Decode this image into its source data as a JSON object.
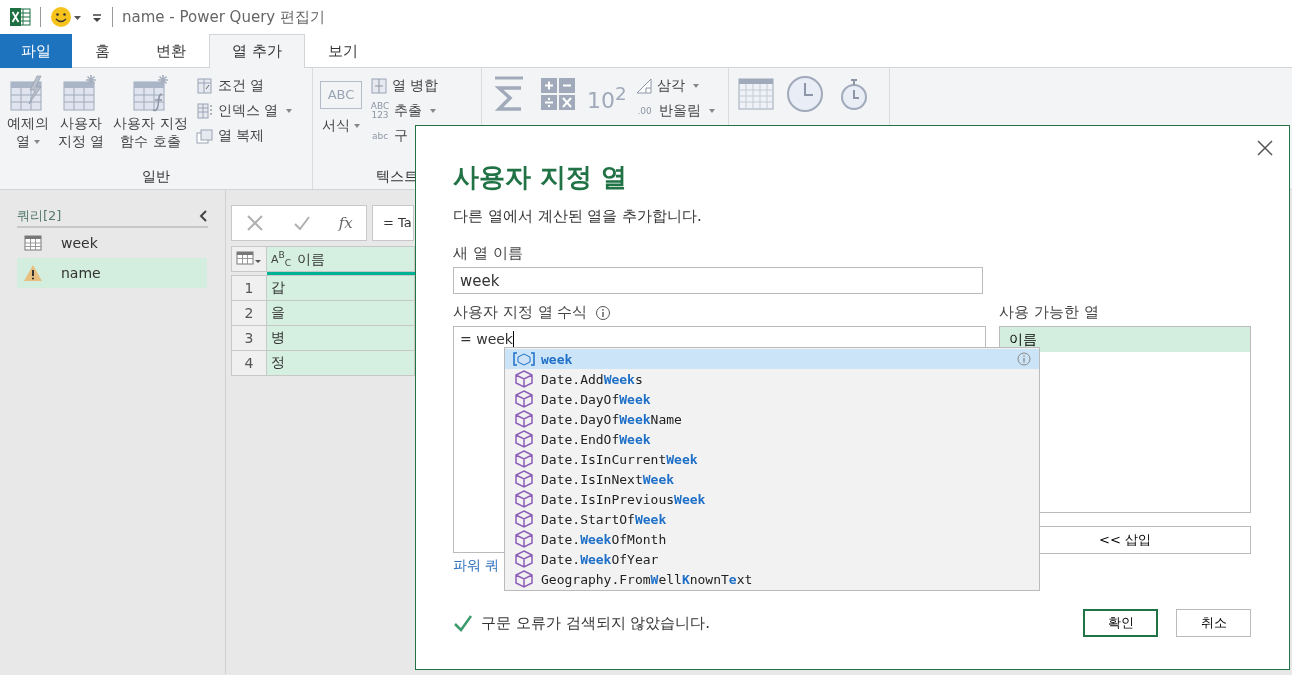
{
  "title_bar": {
    "title": "name - Power Query 편집기"
  },
  "tabs": [
    {
      "label": "파일",
      "kind": "file",
      "selected": false
    },
    {
      "label": "홈",
      "kind": "tab",
      "selected": false
    },
    {
      "label": "변환",
      "kind": "tab",
      "selected": false
    },
    {
      "label": "열 추가",
      "kind": "tab",
      "selected": true
    },
    {
      "label": "보기",
      "kind": "tab",
      "selected": false
    }
  ],
  "ribbon": {
    "groups": [
      {
        "label": "일반",
        "large": [
          {
            "kind": "example",
            "label": "예제의\n열",
            "dropdown": true
          },
          {
            "kind": "custom",
            "label": "사용자\n지정 열",
            "dropdown": false
          },
          {
            "kind": "invoke",
            "label": "사용자 지정\n함수 호출",
            "dropdown": false
          }
        ],
        "small": [
          {
            "kind": "conditional",
            "label": "조건 열",
            "dropdown": false
          },
          {
            "kind": "index",
            "label": "인덱스 열",
            "dropdown": true
          },
          {
            "kind": "duplicate",
            "label": "열 복제",
            "dropdown": false
          }
        ]
      },
      {
        "label": "텍스트",
        "large": [
          {
            "kind": "format",
            "label": "서식",
            "icon_text": "ABC",
            "dropdown": true
          }
        ],
        "small": [
          {
            "kind": "merge",
            "label": "열 병합",
            "dropdown": false
          },
          {
            "kind": "extract",
            "label": "추출",
            "icon_text": "ABC 123",
            "dropdown": true
          },
          {
            "kind": "parse",
            "label": "구",
            "icon_text": "abc",
            "dropdown": false
          }
        ]
      },
      {
        "large": [
          {
            "kind": "statistics"
          },
          {
            "kind": "standard"
          },
          {
            "kind": "scientific",
            "icon_text": "10$^{2}$"
          }
        ],
        "small": [
          {
            "kind": "trigonometry",
            "label": "삼각",
            "dropdown": true
          },
          {
            "kind": "rounding",
            "label": "반올림",
            "icon_text": ".00",
            "dropdown": true
          }
        ]
      },
      {
        "large": [
          {
            "kind": "date"
          },
          {
            "kind": "time"
          },
          {
            "kind": "duration"
          }
        ]
      }
    ]
  },
  "queries": {
    "header": "쿼리[2]",
    "items": [
      {
        "name": "week",
        "kind": "table",
        "selected": false
      },
      {
        "name": "name",
        "kind": "warning",
        "selected": true
      }
    ]
  },
  "formula_bar": {
    "fx": "fx",
    "formula": "= Ta"
  },
  "table": {
    "type_icon": "A$^{B}$$_{C}$",
    "columns": [
      "이름"
    ],
    "rows": [
      {
        "index": "1",
        "cells": [
          "갑"
        ]
      },
      {
        "index": "2",
        "cells": [
          "을"
        ]
      },
      {
        "index": "3",
        "cells": [
          "병"
        ]
      },
      {
        "index": "4",
        "cells": [
          "정"
        ]
      }
    ]
  },
  "dialog": {
    "title": "사용자 지정 열",
    "subtitle": "다른 열에서 계산된 열을 추가합니다.",
    "name_label": "새 열 이름",
    "name_value": "week",
    "formula_label": "사용자 지정 열 수식",
    "formula": "= week",
    "suggestions": [
      {
        "kind": "variable",
        "label": "week",
        "selected": true
      },
      {
        "kind": "function",
        "label": "Date.Add**Week**s",
        "selected": false
      },
      {
        "kind": "function",
        "label": "Date.DayOf**Week**",
        "selected": false
      },
      {
        "kind": "function",
        "label": "Date.DayOf**Week**Name",
        "selected": false
      },
      {
        "kind": "function",
        "label": "Date.EndOf**Week**",
        "selected": false
      },
      {
        "kind": "function",
        "label": "Date.IsInCurrent**Week**",
        "selected": false
      },
      {
        "kind": "function",
        "label": "Date.IsInNext**Week**",
        "selected": false
      },
      {
        "kind": "function",
        "label": "Date.IsInPrevious**Week**",
        "selected": false
      },
      {
        "kind": "function",
        "label": "Date.StartOf**Week**",
        "selected": false
      },
      {
        "kind": "function",
        "label": "Date.**Week**OfMonth",
        "selected": false
      },
      {
        "kind": "function",
        "label": "Date.**Week**OfYear",
        "selected": false
      },
      {
        "kind": "function",
        "label": "Geography.From**W**ell**K**nownT**e**xt",
        "selected": false
      }
    ],
    "available_label": "사용 가능한 열",
    "available": [
      {
        "name": "이름",
        "selected": true
      }
    ],
    "insert_button": "<< 삽입",
    "learn_link": "파워 쿼",
    "status": "구문 오류가 검색되지 않았습니다.",
    "buttons": [
      {
        "label": "확인",
        "default": true
      },
      {
        "label": "취소",
        "default": false
      }
    ]
  }
}
